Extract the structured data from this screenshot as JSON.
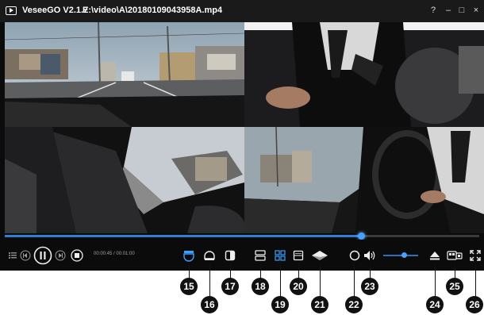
{
  "window": {
    "app_name": "VeseeGO V2.1.7",
    "file_path": "E:\\video\\A\\20180109043958A.mp4",
    "help": "?",
    "minimize": "–",
    "maximize": "□",
    "close": "×"
  },
  "playback": {
    "time": "00:00:45 / 00:01:00",
    "progress": 0.75,
    "volume": 0.6
  },
  "callouts": [
    "15",
    "16",
    "17",
    "18",
    "19",
    "20",
    "21",
    "22",
    "23",
    "24",
    "25",
    "26"
  ],
  "icons": [
    "list-icon",
    "previous-icon",
    "pause-icon",
    "next-icon",
    "stop-icon",
    "front-half-view-icon",
    "rear-half-view-icon",
    "side-view-icon",
    "dual-view-icon",
    "quad-view-icon",
    "panorama-view-icon",
    "ground-view-icon",
    "rotate-icon",
    "volume-icon",
    "eject-icon",
    "snapshot-icon",
    "fullscreen-icon"
  ],
  "colors": {
    "accent": "#2f7fd6",
    "active_icon": "#3aa0ff",
    "window_bg": "#0b0b0b"
  }
}
